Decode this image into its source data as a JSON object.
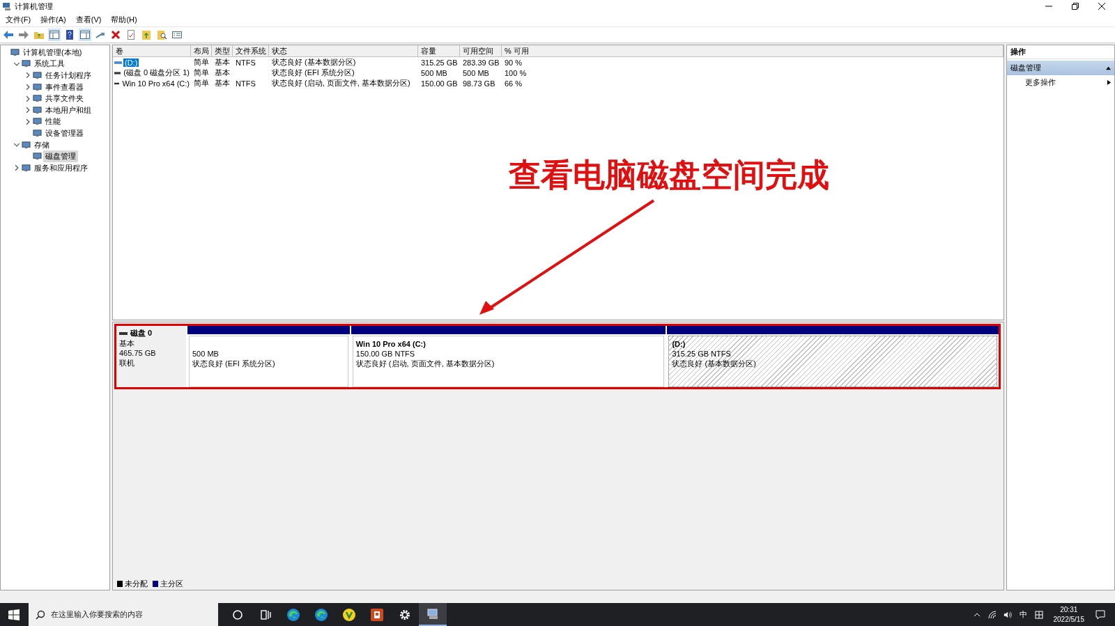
{
  "window": {
    "title": "计算机管理"
  },
  "menu": [
    "文件(F)",
    "操作(A)",
    "查看(V)",
    "帮助(H)"
  ],
  "tree": [
    {
      "label": "计算机管理(本地)",
      "selected": false,
      "children": [
        {
          "label": "系统工具",
          "expanded": true,
          "selected": false,
          "children": [
            {
              "label": "任务计划程序",
              "expanded": false,
              "selected": false
            },
            {
              "label": "事件查看器",
              "expanded": false,
              "selected": false
            },
            {
              "label": "共享文件夹",
              "expanded": false,
              "selected": false
            },
            {
              "label": "本地用户和组",
              "expanded": false,
              "selected": false
            },
            {
              "label": "性能",
              "expanded": false,
              "selected": false
            },
            {
              "label": "设备管理器",
              "selected": false
            }
          ]
        },
        {
          "label": "存储",
          "expanded": true,
          "selected": false,
          "children": [
            {
              "label": "磁盘管理",
              "selected": true
            }
          ]
        },
        {
          "label": "服务和应用程序",
          "expanded": false,
          "selected": false
        }
      ]
    }
  ],
  "volumes": {
    "columns": [
      "卷",
      "布局",
      "类型",
      "文件系统",
      "状态",
      "容量",
      "可用空间",
      "% 可用"
    ],
    "rows": [
      {
        "selected": true,
        "cells": [
          "(D:)",
          "简单",
          "基本",
          "NTFS",
          "状态良好 (基本数据分区)",
          "315.25 GB",
          "283.39 GB",
          "90 %"
        ]
      },
      {
        "selected": false,
        "cells": [
          "(磁盘 0 磁盘分区 1)",
          "简单",
          "基本",
          "",
          "状态良好 (EFI 系统分区)",
          "500 MB",
          "500 MB",
          "100 %"
        ]
      },
      {
        "selected": false,
        "cells": [
          "Win 10 Pro x64 (C:)",
          "简单",
          "基本",
          "NTFS",
          "状态良好 (启动, 页面文件, 基本数据分区)",
          "150.00 GB",
          "98.73 GB",
          "66 %"
        ]
      }
    ]
  },
  "disk": {
    "name": "磁盘 0",
    "type": "基本",
    "size": "465.75 GB",
    "status": "联机",
    "partitions": [
      {
        "size": "500 MB",
        "status": "状态良好 (EFI 系统分区)",
        "selected": false
      },
      {
        "title": "Win 10 Pro x64  (C:)",
        "size": "150.00 GB NTFS",
        "status": "状态良好 (启动, 页面文件, 基本数据分区)",
        "selected": false
      },
      {
        "title": "(D:)",
        "size": "315.25 GB NTFS",
        "status": "状态良好 (基本数据分区)",
        "selected": true
      }
    ]
  },
  "legend": [
    {
      "label": "未分配",
      "color": "#000000"
    },
    {
      "label": "主分区",
      "color": "#000080"
    }
  ],
  "actions": {
    "title": "操作",
    "section": "磁盘管理",
    "items": [
      "更多操作"
    ]
  },
  "annotation": {
    "text": "查看电脑磁盘空间完成"
  },
  "taskbar": {
    "search_placeholder": "在这里输入你要搜索的内容",
    "apps": [
      {
        "kind": "cortana",
        "selected": false
      },
      {
        "kind": "taskview",
        "selected": false
      },
      {
        "kind": "edge",
        "selected": false
      },
      {
        "kind": "edge",
        "selected": false
      },
      {
        "kind": "app",
        "selected": false
      },
      {
        "kind": "powerpoint",
        "selected": false
      },
      {
        "kind": "settings",
        "selected": false
      },
      {
        "kind": "computer",
        "selected": true
      }
    ],
    "ime": "中",
    "time": "20:31",
    "date": "2022/5/15"
  }
}
